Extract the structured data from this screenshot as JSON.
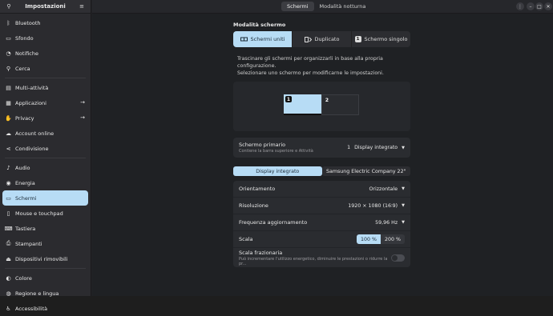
{
  "sidebar": {
    "title": "Impostazioni",
    "items": [
      {
        "label": "Bluetooth",
        "icon": "bluetooth-icon",
        "glyph": "ᛒ"
      },
      {
        "label": "Sfondo",
        "icon": "wallpaper-icon",
        "glyph": "▭"
      },
      {
        "label": "Notifiche",
        "icon": "bell-icon",
        "glyph": "◔"
      },
      {
        "label": "Cerca",
        "icon": "search-icon",
        "glyph": "⚲"
      },
      {
        "label": "Multi-attività",
        "icon": "multitasking-icon",
        "glyph": "▤"
      },
      {
        "label": "Applicazioni",
        "icon": "apps-icon",
        "glyph": "▦",
        "arrow": "→"
      },
      {
        "label": "Privacy",
        "icon": "hand-icon",
        "glyph": "✋",
        "arrow": "→"
      },
      {
        "label": "Account online",
        "icon": "cloud-icon",
        "glyph": "☁"
      },
      {
        "label": "Condivisione",
        "icon": "share-icon",
        "glyph": "⋖"
      },
      {
        "label": "Audio",
        "icon": "speaker-icon",
        "glyph": "♪"
      },
      {
        "label": "Energia",
        "icon": "power-icon",
        "glyph": "◉"
      },
      {
        "label": "Schermi",
        "icon": "display-icon",
        "glyph": "▭",
        "active": true
      },
      {
        "label": "Mouse e touchpad",
        "icon": "mouse-icon",
        "glyph": "▯"
      },
      {
        "label": "Tastiera",
        "icon": "keyboard-icon",
        "glyph": "⌨"
      },
      {
        "label": "Stampanti",
        "icon": "printer-icon",
        "glyph": "⎙"
      },
      {
        "label": "Dispositivi rimovibili",
        "icon": "usb-icon",
        "glyph": "⏏"
      },
      {
        "label": "Colore",
        "icon": "color-icon",
        "glyph": "◐"
      },
      {
        "label": "Regione e lingua",
        "icon": "globe-icon",
        "glyph": "◍"
      },
      {
        "label": "Accessibilità",
        "icon": "accessibility-icon",
        "glyph": "♿"
      }
    ]
  },
  "topbar": {
    "tabs": [
      "Schermi",
      "Modalità notturna"
    ],
    "menu_glyph": "⋮",
    "min_glyph": "–",
    "max_glyph": "□",
    "close_glyph": "✕"
  },
  "mode": {
    "title": "Modalità schermo",
    "options": [
      "Schermi uniti",
      "Duplicato",
      "Schermo singolo"
    ],
    "single_badge": "1"
  },
  "desc": {
    "line1": "Trascinare gli schermi per organizzarli in base alla propria configurazione.",
    "line2": "Selezionare uno schermo per modificarne le impostazioni."
  },
  "arrangement": {
    "mon1": "1",
    "mon2": "2"
  },
  "primary": {
    "label": "Schermo primario",
    "sub": "Contiene la barra superiore e Attività",
    "num": "1",
    "value": "Display integrato"
  },
  "display_tabs": [
    "Display integrato",
    "Samsung Electric Company 22\""
  ],
  "settings": {
    "orientation": {
      "label": "Orientamento",
      "value": "Orizzontale"
    },
    "resolution": {
      "label": "Risoluzione",
      "value": "1920 × 1080 (16∶9)"
    },
    "refresh": {
      "label": "Frequenza aggiornamento",
      "value": "59,96 Hz"
    },
    "scale": {
      "label": "Scala",
      "options": [
        "100 %",
        "200 %"
      ]
    },
    "fractional": {
      "label": "Scala frazionaria",
      "sub": "Può incrementare l'utilizzo energetico, diminuire le prestazioni o ridurre la pr..."
    }
  },
  "colors": {
    "accent": "#b7dcf5",
    "bg": "#1f2124",
    "card": "#2a2c30"
  }
}
